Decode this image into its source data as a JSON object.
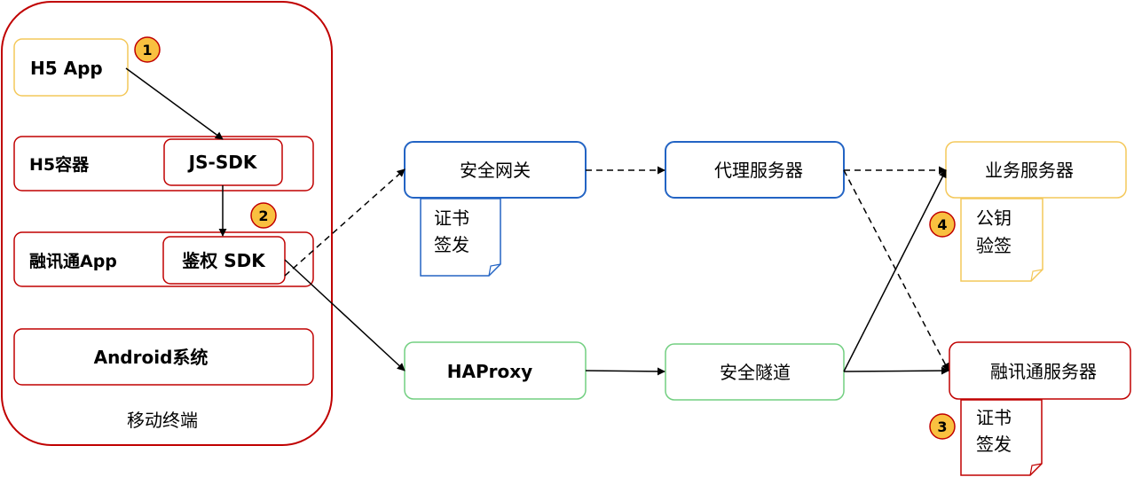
{
  "colors": {
    "red": "#c00000",
    "yellow": "#f4c85a",
    "blue": "#2364c4",
    "green": "#72cf81",
    "badge_fill": "#f9c040",
    "badge_stroke": "#c00000"
  },
  "mobile_terminal": {
    "label": "移动终端",
    "h5_app": "H5 App",
    "h5_container": "H5容器",
    "js_sdk": "JS-SDK",
    "rongxuntong_app": "融讯通App",
    "auth_sdk": "鉴权 SDK",
    "android": "Android系统"
  },
  "nodes": {
    "security_gateway": "安全网关",
    "proxy_server": "代理服务器",
    "business_server": "业务服务器",
    "haproxy": "HAProxy",
    "security_tunnel": "安全隧道",
    "rongxuntong_server": "融讯通服务器"
  },
  "notes": {
    "gateway_cert": {
      "line1": "证书",
      "line2": "签发"
    },
    "public_key_verify": {
      "line1": "公钥",
      "line2": "验签"
    },
    "server_cert": {
      "line1": "证书",
      "line2": "签发"
    }
  },
  "badges": {
    "b1": "1",
    "b2": "2",
    "b3": "3",
    "b4": "4"
  }
}
